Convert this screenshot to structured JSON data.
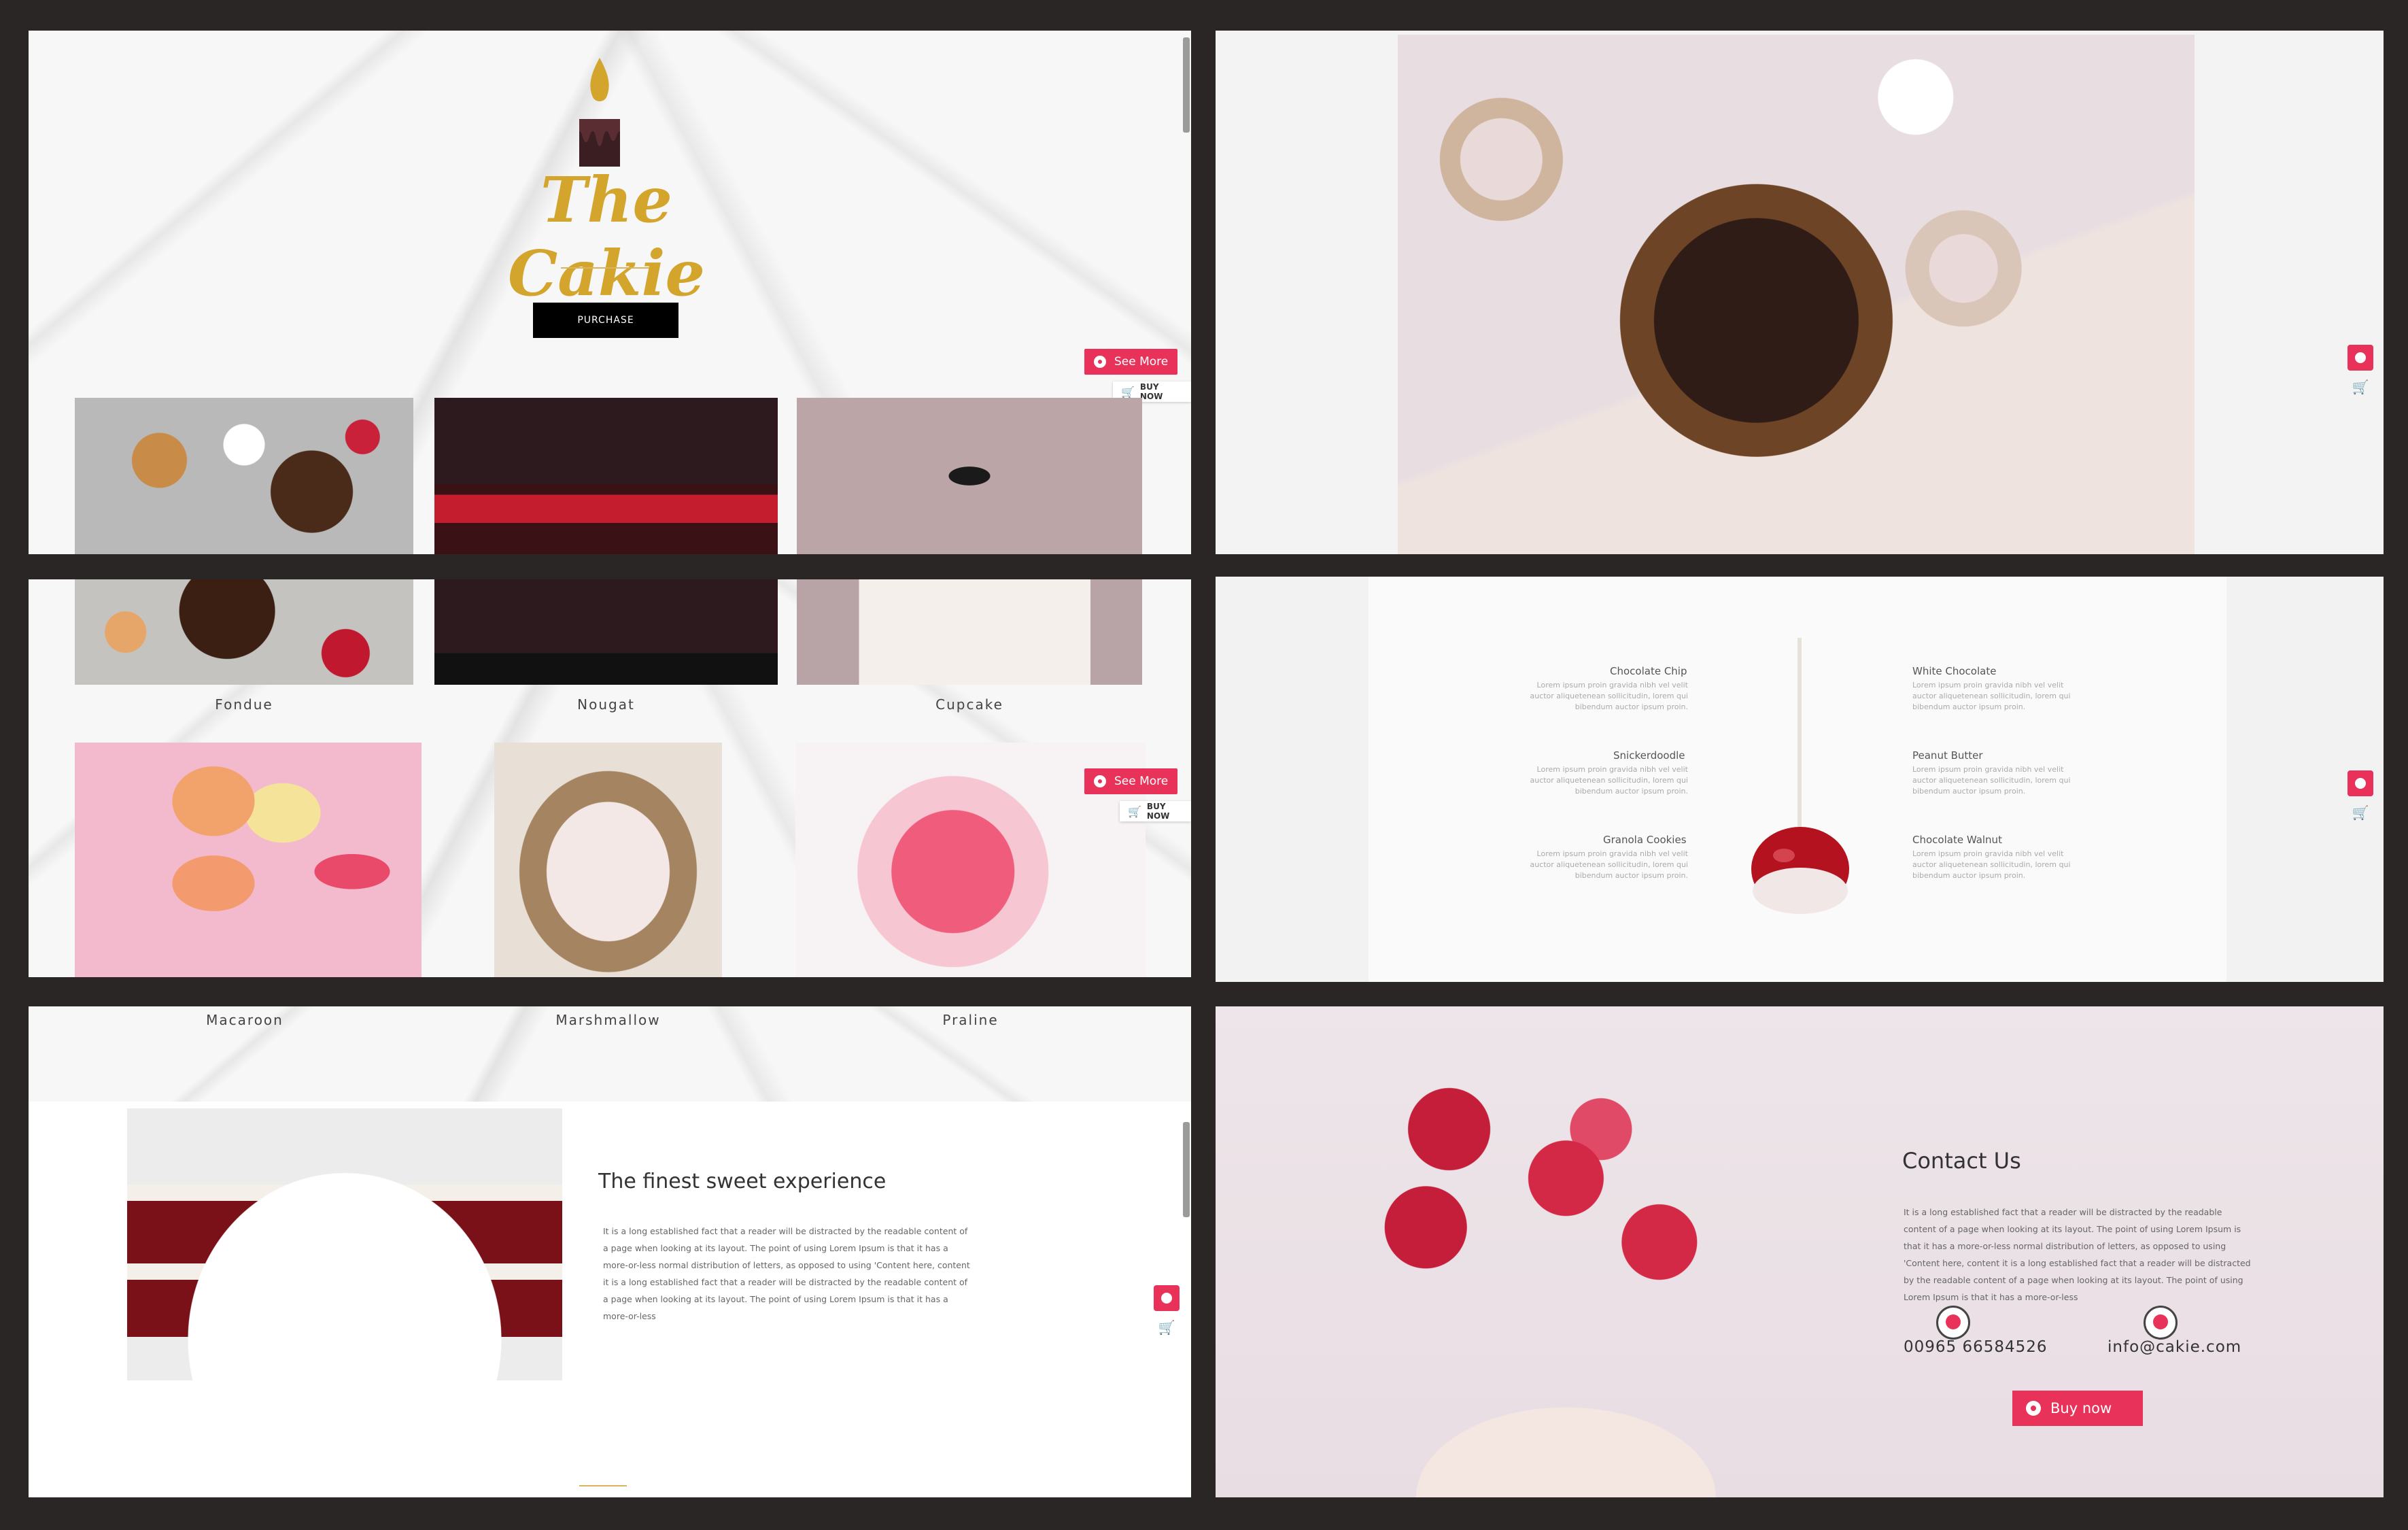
{
  "hero": {
    "brand": "The Cakie",
    "purchase_label": "PURCHASE",
    "see_more_label": "See More",
    "buy_now_label": "BUY NOW"
  },
  "products_row1": [
    {
      "name": "Fondue"
    },
    {
      "name": "Nougat"
    },
    {
      "name": "Cupcake"
    }
  ],
  "products_row2": [
    {
      "name": "Macaroon"
    },
    {
      "name": "Marshmallow"
    },
    {
      "name": "Praline"
    }
  ],
  "menu": {
    "items": [
      {
        "title": "Chocolate Chip",
        "desc": "Lorem ipsum proin gravida nibh vel velit auctor aliquetenean sollicitudin, lorem qui bibendum auctor ipsum proin."
      },
      {
        "title": "White Chocolate",
        "desc": "Lorem ipsum proin gravida nibh vel velit auctor aliquetenean sollicitudin, lorem qui bibendum auctor ipsum proin."
      },
      {
        "title": "Snickerdoodle",
        "desc": "Lorem ipsum proin gravida nibh vel velit auctor aliquetenean sollicitudin, lorem qui bibendum auctor ipsum proin."
      },
      {
        "title": "Peanut Butter",
        "desc": "Lorem ipsum proin gravida nibh vel velit auctor aliquetenean sollicitudin, lorem qui bibendum auctor ipsum proin."
      },
      {
        "title": "Granola Cookies",
        "desc": "Lorem ipsum proin gravida nibh vel velit auctor aliquetenean sollicitudin, lorem qui bibendum auctor ipsum proin."
      },
      {
        "title": "Chocolate Walnut",
        "desc": "Lorem ipsum proin gravida nibh vel velit auctor aliquetenean sollicitudin, lorem qui bibendum auctor ipsum proin."
      }
    ]
  },
  "about": {
    "heading": "The finest sweet experience",
    "body": "It is a long established fact that a reader will be distracted by the readable content of a page when looking at its layout. The point of using Lorem Ipsum is that it has a more-or-less normal distribution of letters, as opposed to using 'Content here, content it is a long established fact that a reader will be distracted by the readable content of a page when looking at its layout. The point of using Lorem Ipsum is that it has a more-or-less"
  },
  "contact": {
    "heading": "Contact Us",
    "body": "It is a long established fact that a reader will be distracted by the readable content of a page when looking at its layout. The point of using Lorem Ipsum is that it has a more-or-less normal distribution of letters, as opposed to using 'Content here, content it is a long established fact that a reader will be distracted by the readable content of a page when looking at its layout. The point of using Lorem Ipsum is that it has a more-or-less",
    "phone": "00965 66584526",
    "email": "info@cakie.com",
    "buy_label": "Buy now"
  },
  "colors": {
    "accent": "#e8325a",
    "gold": "#d4a52c",
    "background": "#2a2626"
  }
}
